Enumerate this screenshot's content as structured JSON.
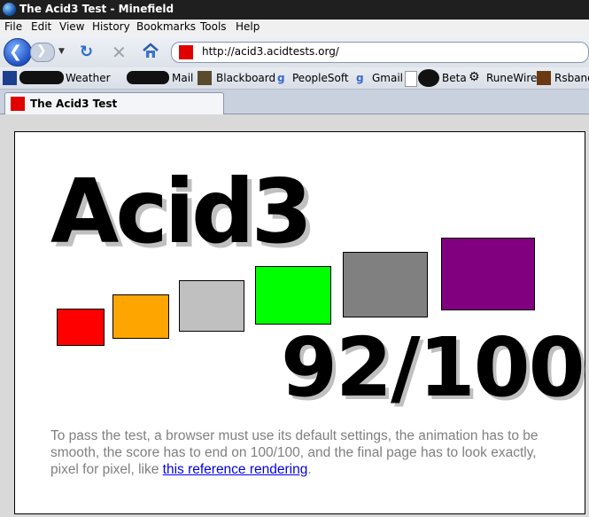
{
  "window": {
    "title": "The Acid3 Test - Minefield"
  },
  "menu": [
    "File",
    "Edit",
    "View",
    "History",
    "Bookmarks",
    "Tools",
    "Help"
  ],
  "nav": {
    "url": "http://acid3.acidtests.org/"
  },
  "bookmarks": [
    {
      "label": "Weather",
      "icon": "twc-icon"
    },
    {
      "label": "Mail",
      "icon": "mail-icon"
    },
    {
      "label": "Blackboard",
      "icon": "blackboard-icon"
    },
    {
      "label": "PeopleSoft",
      "icon": "google-icon"
    },
    {
      "label": "Gmail",
      "icon": "google-icon"
    },
    {
      "label": "Beta",
      "icon": "page-icon"
    },
    {
      "label": "RuneWire",
      "icon": "gear-icon"
    },
    {
      "label": "Rsband",
      "icon": "rsband-icon"
    }
  ],
  "tab": {
    "label": "The Acid3 Test"
  },
  "page": {
    "title": "Acid3",
    "score": "92/100",
    "box_colors": [
      "#ff0000",
      "#ffa500",
      "#c0c0c0",
      "#00ff00",
      "#808080",
      "#800080"
    ],
    "instructions_prefix": "To pass the test, a browser must use its default settings, the animation has to be smooth, the score has to end on 100/100, and the final page has to look exactly, pixel for pixel, like ",
    "link_text": "this reference rendering",
    "instructions_suffix": "."
  }
}
